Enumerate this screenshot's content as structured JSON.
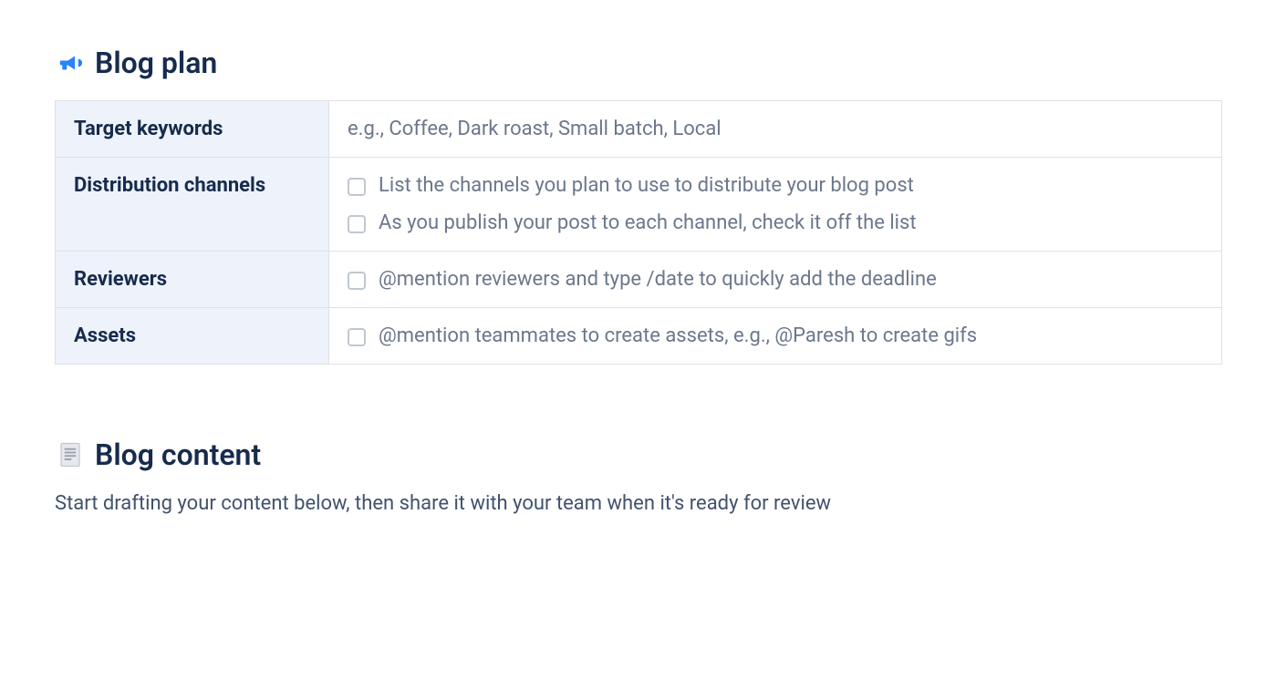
{
  "blog_plan": {
    "title": "Blog plan",
    "rows": {
      "target_keywords": {
        "label": "Target keywords",
        "placeholder": "e.g., Coffee, Dark roast, Small batch, Local"
      },
      "distribution_channels": {
        "label": "Distribution channels",
        "items": [
          "List the channels you plan to use to distribute your blog post",
          "As you publish your post to each channel, check it off the list"
        ]
      },
      "reviewers": {
        "label": "Reviewers",
        "items": [
          "@mention reviewers and type /date to quickly add the deadline"
        ]
      },
      "assets": {
        "label": "Assets",
        "items": [
          "@mention teammates to create assets, e.g., @Paresh to create gifs"
        ]
      }
    }
  },
  "blog_content": {
    "title": "Blog content",
    "description": "Start drafting your content below, then share it with your team when it's ready for review"
  }
}
